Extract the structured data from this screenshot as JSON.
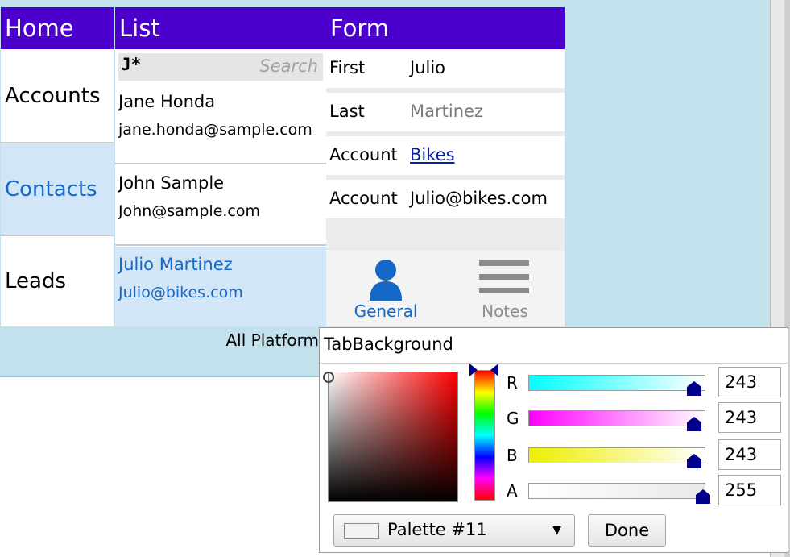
{
  "nav": {
    "header": "Home",
    "items": [
      {
        "label": "Accounts",
        "selected": false
      },
      {
        "label": "Contacts",
        "selected": true
      },
      {
        "label": "Leads",
        "selected": false
      }
    ]
  },
  "list": {
    "header": "List",
    "search": {
      "query": "J*",
      "placeholder": "Search"
    },
    "items": [
      {
        "name": "Jane Honda",
        "email": "jane.honda@sample.com"
      },
      {
        "name": "John Sample",
        "email": "John@sample.com"
      },
      {
        "name": "Julio Martinez",
        "email": "Julio@bikes.com",
        "selected": true
      }
    ]
  },
  "form": {
    "header": "Form",
    "fields": [
      {
        "label": "First",
        "value": "Julio"
      },
      {
        "label": "Last",
        "value": "Martinez"
      },
      {
        "label": "Account",
        "value": "Bikes"
      },
      {
        "label": "Account",
        "value": "Julio@bikes.com"
      }
    ],
    "tabs": [
      {
        "label": "General",
        "icon": "person-icon",
        "selected": true
      },
      {
        "label": "Notes",
        "icon": "notes-icon",
        "selected": false
      }
    ]
  },
  "footer": {
    "text": "All Platform"
  },
  "color_picker": {
    "title": "TabBackground",
    "channels": [
      {
        "label": "R",
        "value": "243"
      },
      {
        "label": "G",
        "value": "243"
      },
      {
        "label": "B",
        "value": "243"
      },
      {
        "label": "A",
        "value": "255"
      }
    ],
    "palette_label": "Palette #11",
    "done_label": "Done"
  },
  "colors": {
    "accent": "#4b00cd",
    "selection": "#d2e6f8",
    "link": "#1468c7",
    "backdrop": "#c2e1ec",
    "thumb": "#00008b"
  }
}
